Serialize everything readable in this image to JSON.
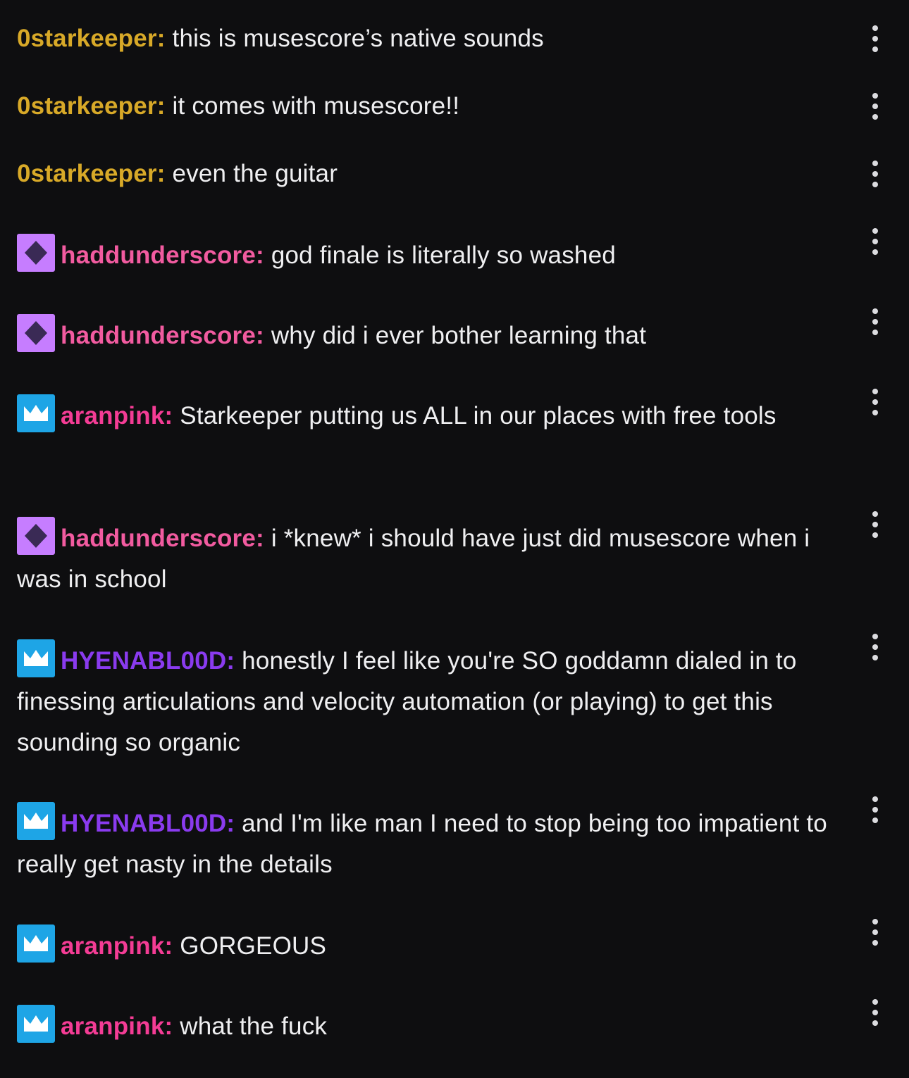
{
  "chat": {
    "messages": [
      {
        "user": "0starkeeper:",
        "color": "#d8a928",
        "badge": "none",
        "text": "this is musescore’s native sounds"
      },
      {
        "user": "0starkeeper:",
        "color": "#d8a928",
        "badge": "none",
        "text": "it comes with musescore!!"
      },
      {
        "user": "0starkeeper:",
        "color": "#d8a928",
        "badge": "none",
        "text": "even the guitar"
      },
      {
        "user": "haddunderscore:",
        "color": "#f25ba0",
        "badge": "diamond-badge-icon",
        "text": "god finale is literally so washed"
      },
      {
        "user": "haddunderscore:",
        "color": "#f25ba0",
        "badge": "diamond-badge-icon",
        "text": "why did i ever bother learning that"
      },
      {
        "user": "aranpink:",
        "color": "#f43c95",
        "badge": "crown-badge-icon",
        "text": "Starkeeper putting us ALL in our places with free tools"
      },
      {
        "user": "haddunderscore:",
        "color": "#f25ba0",
        "badge": "diamond-badge-icon",
        "text": "i *knew* i should have just did musescore when i was in school"
      },
      {
        "user": "HYENABL00D:",
        "color": "#8a3bef",
        "badge": "crown-badge-icon",
        "text": "honestly I feel like you're SO goddamn dialed in to finessing articulations and velocity automation (or playing) to get this sounding so organic"
      },
      {
        "user": "HYENABL00D:",
        "color": "#8a3bef",
        "badge": "crown-badge-icon",
        "text": "and I'm like man I need to stop being too impatient to really get nasty in the details"
      },
      {
        "user": "aranpink:",
        "color": "#f43c95",
        "badge": "crown-badge-icon",
        "text": "GORGEOUS"
      },
      {
        "user": "aranpink:",
        "color": "#f43c95",
        "badge": "crown-badge-icon",
        "text": "what the fuck"
      }
    ],
    "badge_colors": {
      "diamond": "#c67dff",
      "crown": "#1ea5e6"
    },
    "text_color": "#efeff1",
    "background": "#0e0e10",
    "menu_icon": "more-vertical-icon"
  }
}
